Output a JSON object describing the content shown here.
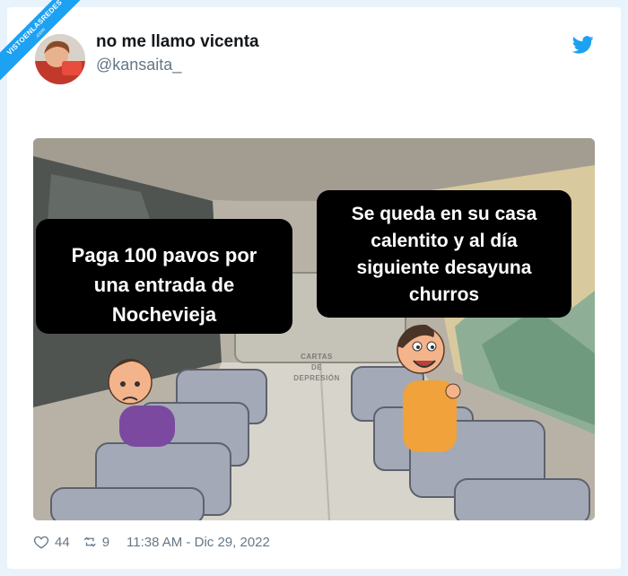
{
  "ribbon": {
    "text": "VISTOENLASREDES",
    "sub": ".com"
  },
  "author": {
    "name": "no me llamo vicenta",
    "handle": "@kansaita_"
  },
  "meme": {
    "left_lines": [
      "Paga 100 pavos por",
      "una entrada de",
      "Nochevieja"
    ],
    "right_lines": [
      "Se queda en su casa",
      "calentito y al día",
      "siguiente desayuna",
      "churros"
    ],
    "watermark_lines": [
      "CARTAS",
      "DE",
      "DEPRESIÓN"
    ]
  },
  "footer": {
    "likes": "44",
    "retweets": "9",
    "timestamp": "11:38 AM - Dic 29, 2022"
  },
  "icons": {
    "brand": "twitter-bird-icon",
    "like": "heart-icon",
    "retweet": "retweet-icon"
  },
  "colors": {
    "twitter_blue": "#1da1f2",
    "background": "#e9f3fb",
    "muted": "#657786"
  }
}
